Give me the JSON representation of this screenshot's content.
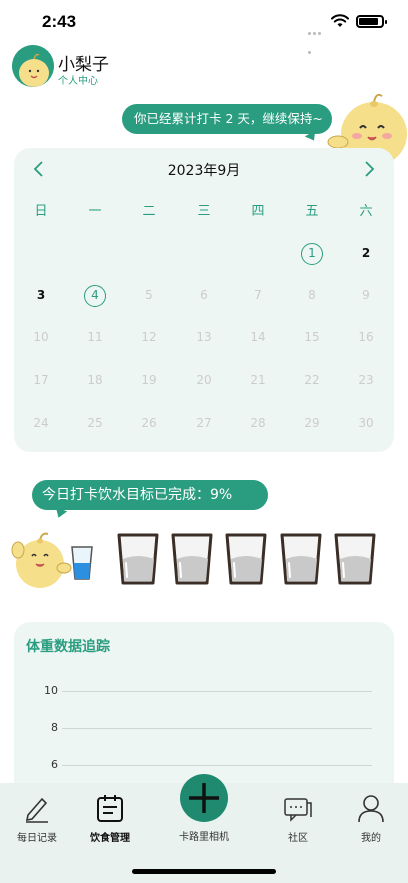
{
  "status_bar": {
    "time": "2:43"
  },
  "profile": {
    "name": "小梨子",
    "link": "个人中心"
  },
  "streak_message": "你已经累计打卡 2 天，继续保持~",
  "calendar": {
    "title": "2023年9月",
    "weekdays": [
      "日",
      "一",
      "二",
      "三",
      "四",
      "五",
      "六"
    ],
    "days": [
      {
        "label": "1",
        "state": "checked"
      },
      {
        "label": "2",
        "state": "active"
      },
      {
        "label": "3",
        "state": "active"
      },
      {
        "label": "4",
        "state": "checked"
      },
      {
        "label": "5"
      },
      {
        "label": "6"
      },
      {
        "label": "7"
      },
      {
        "label": "8"
      },
      {
        "label": "9"
      },
      {
        "label": "10"
      },
      {
        "label": "11"
      },
      {
        "label": "12"
      },
      {
        "label": "13"
      },
      {
        "label": "14"
      },
      {
        "label": "15"
      },
      {
        "label": "16"
      },
      {
        "label": "17"
      },
      {
        "label": "18"
      },
      {
        "label": "19"
      },
      {
        "label": "20"
      },
      {
        "label": "21"
      },
      {
        "label": "22"
      },
      {
        "label": "23"
      },
      {
        "label": "24"
      },
      {
        "label": "25"
      },
      {
        "label": "26"
      },
      {
        "label": "27"
      },
      {
        "label": "28"
      },
      {
        "label": "29"
      },
      {
        "label": "30"
      }
    ]
  },
  "water": {
    "message": "今日打卡饮水目标已完成：9%",
    "cups_empty": 5
  },
  "weight": {
    "title": "体重数据追踪",
    "y_ticks": [
      "10",
      "8",
      "6"
    ]
  },
  "tab_bar": {
    "items": [
      {
        "label": "每日记录",
        "icon": "pen-icon"
      },
      {
        "label": "饮食管理",
        "icon": "calendar-icon",
        "active": true
      },
      {
        "label": "卡路里相机",
        "icon": "plus-icon"
      },
      {
        "label": "社区",
        "icon": "chat-icon"
      },
      {
        "label": "我的",
        "icon": "user-icon"
      }
    ]
  },
  "colors": {
    "accent": "#2a9d80",
    "card_bg": "#eef6f3",
    "tab_bg": "#e9f2ef"
  }
}
